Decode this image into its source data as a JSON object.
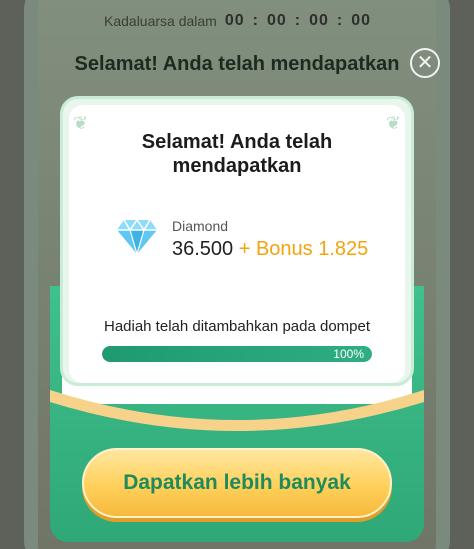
{
  "background": {
    "timer_label": "Kadaluarsa dalam",
    "timer": [
      "00",
      "00",
      "00",
      "00"
    ],
    "title": "Selamat! Anda telah mendapatkan"
  },
  "popup": {
    "title_line1": "Selamat! Anda telah",
    "title_line2": "mendapatkan",
    "reward": {
      "icon": "diamond-icon",
      "name": "Diamond",
      "amount": "36.500",
      "bonus": "+ Bonus 1.825"
    },
    "added_text": "Hadiah telah ditambahkan pada dompet",
    "progress": {
      "percent": 100,
      "label": "100%"
    },
    "cta_label": "Dapatkan lebih banyak"
  },
  "colors": {
    "accent_green": "#2fa877",
    "bonus_orange": "#f2a40e",
    "button_yellow": "#ffd05a"
  }
}
